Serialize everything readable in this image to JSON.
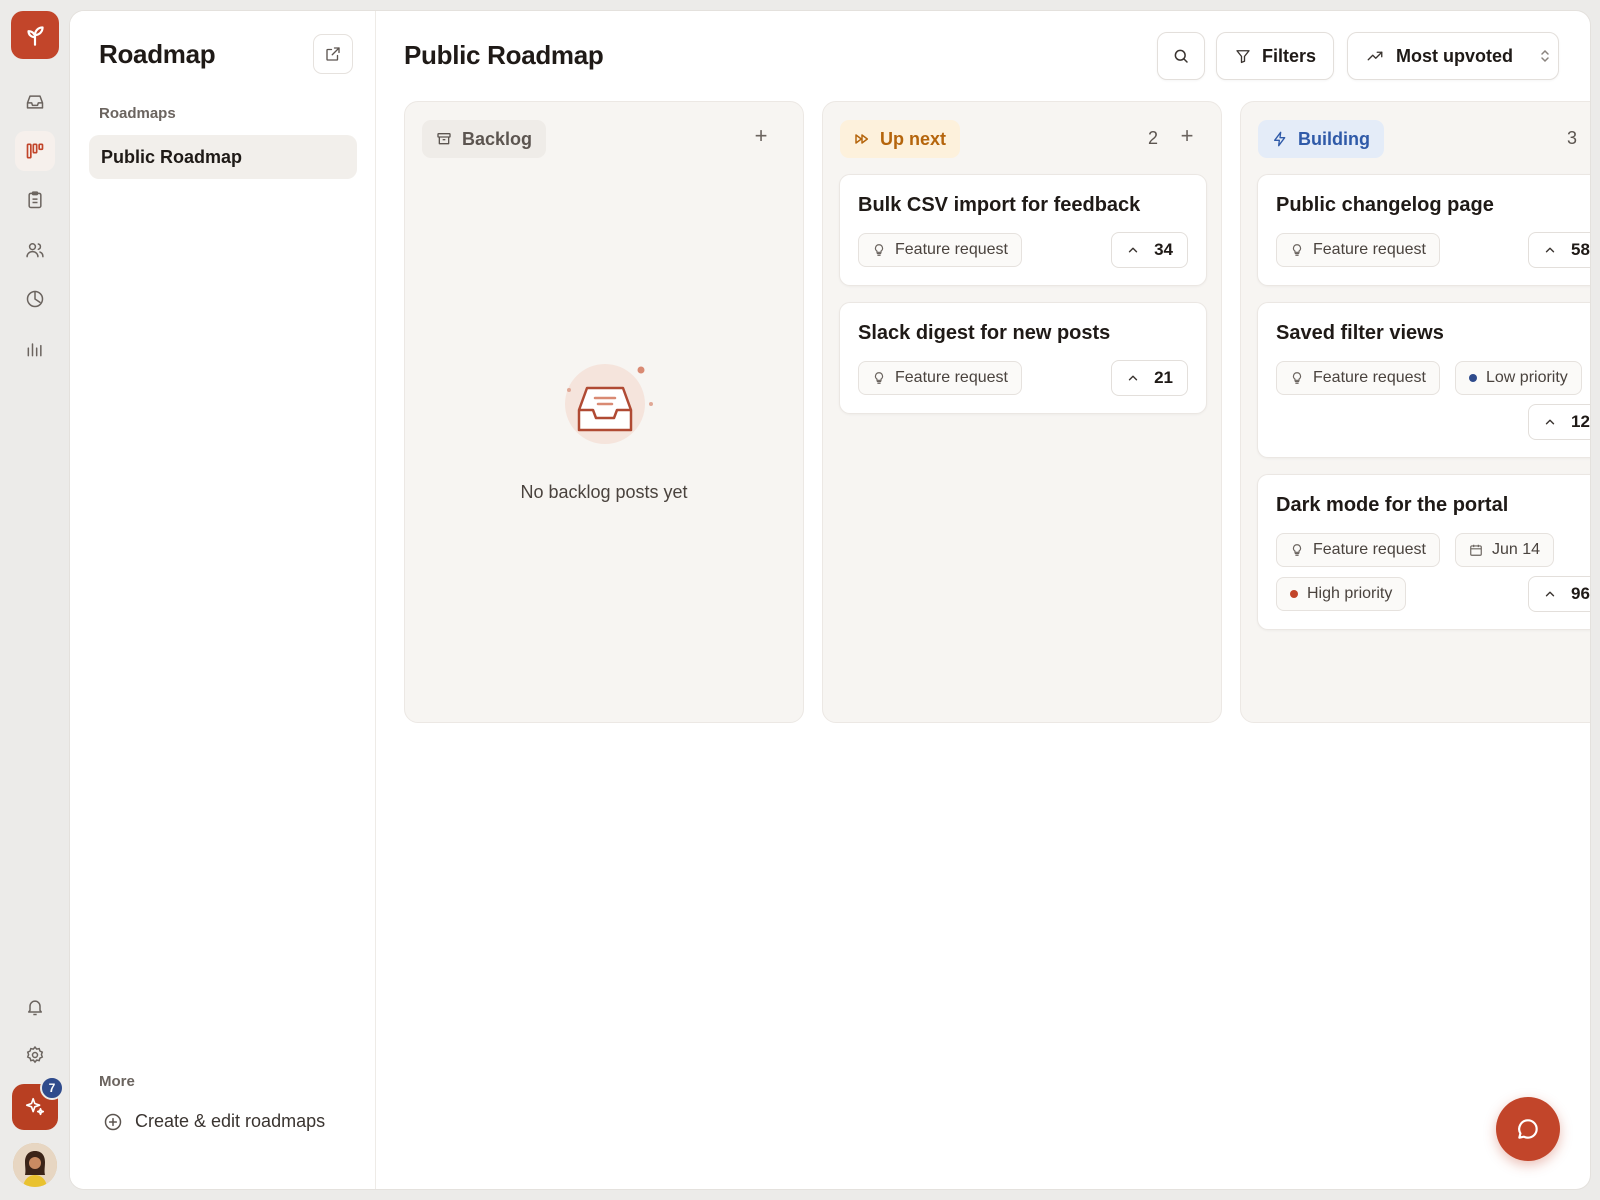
{
  "sidebar": {
    "title": "Roadmap",
    "section_label": "Roadmaps",
    "items": [
      {
        "label": "Public Roadmap",
        "active": true
      }
    ],
    "more_label": "More",
    "create_label": "Create & edit roadmaps"
  },
  "rail": {
    "icons": [
      "logo-icon",
      "inbox-icon",
      "roadmap-icon",
      "clipboard-icon",
      "users-icon",
      "clock-icon",
      "chart-icon",
      "bell-icon",
      "gear-icon",
      "sparkle-icon"
    ],
    "ai_badge_count": "7"
  },
  "header": {
    "title": "Public Roadmap",
    "filters_label": "Filters",
    "sort_label": "Most upvoted"
  },
  "columns": [
    {
      "name": "Backlog",
      "count": "",
      "empty_text": "No backlog posts yet",
      "cards": []
    },
    {
      "name": "Up next",
      "count": "2",
      "cards": [
        {
          "title": "Bulk CSV import for feedback",
          "tag": "Feature request",
          "votes": "34"
        },
        {
          "title": "Slack digest for new posts",
          "tag": "Feature request",
          "votes": "21"
        }
      ]
    },
    {
      "name": "Building",
      "count": "3",
      "cards": [
        {
          "title": "Public changelog page",
          "tag": "Feature request",
          "votes": "58"
        },
        {
          "title": "Saved filter views",
          "tag": "Feature request",
          "priority": "Low priority",
          "votes": "12"
        },
        {
          "title": "Dark mode for the portal",
          "tag": "Feature request",
          "date": "Jun 14",
          "priority": "High priority",
          "votes": "96"
        }
      ]
    }
  ],
  "colors": {
    "brand": "#c2452a",
    "up_next_bg": "#fdf1dc",
    "up_next_text": "#b5650c",
    "building_bg": "#e4ecf8",
    "building_text": "#2f5aa8",
    "low_priority": "#2f4b8c",
    "high_priority": "#c2452a"
  }
}
